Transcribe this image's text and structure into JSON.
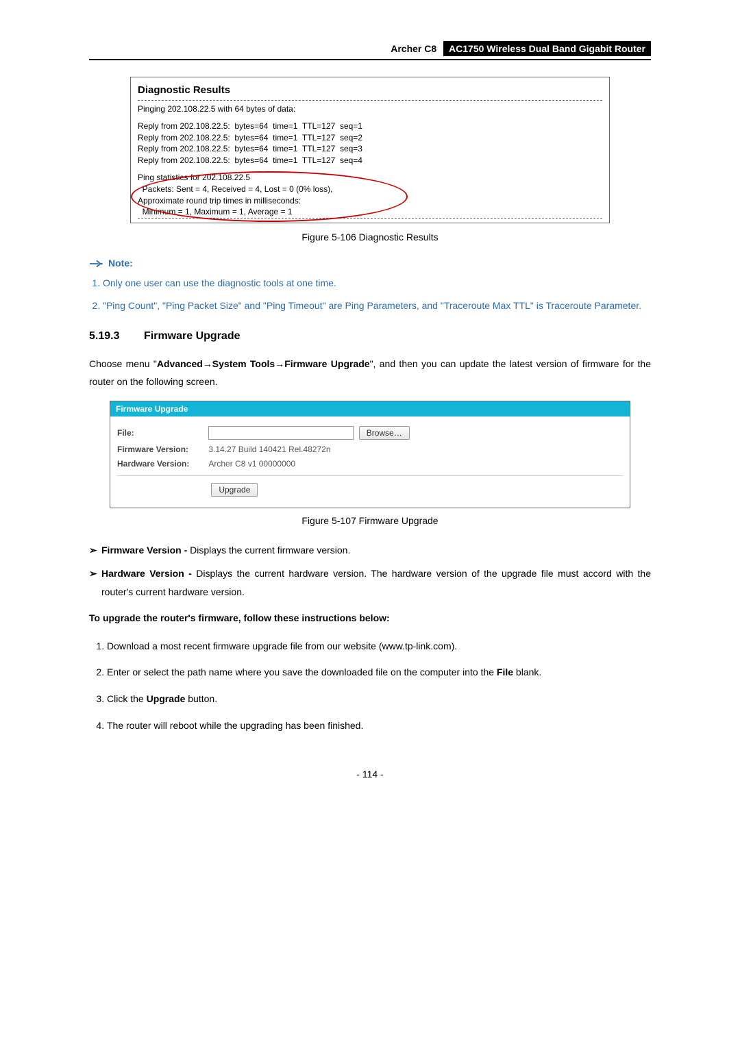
{
  "header": {
    "model": "Archer C8",
    "title": "AC1750 Wireless Dual Band Gigabit Router"
  },
  "diag": {
    "title": "Diagnostic Results",
    "ping_header": "Pinging 202.108.22.5 with 64 bytes of data:",
    "replies": [
      "Reply from 202.108.22.5:  bytes=64  time=1  TTL=127  seq=1",
      "Reply from 202.108.22.5:  bytes=64  time=1  TTL=127  seq=2",
      "Reply from 202.108.22.5:  bytes=64  time=1  TTL=127  seq=3",
      "Reply from 202.108.22.5:  bytes=64  time=1  TTL=127  seq=4"
    ],
    "stats": [
      "Ping statistics for 202.108.22.5",
      "  Packets: Sent = 4, Received = 4, Lost = 0 (0% loss),",
      "Approximate round trip times in milliseconds:",
      "  Minimum = 1, Maximum = 1, Average = 1"
    ],
    "caption": "Figure 5-106 Diagnostic Results"
  },
  "note": {
    "label": "Note:",
    "items": [
      "Only one user can use the diagnostic tools at one time.",
      "\"Ping Count\", \"Ping Packet Size\" and \"Ping Timeout\" are Ping Parameters, and \"Traceroute Max TTL\" is Traceroute Parameter."
    ]
  },
  "section": {
    "num": "5.19.3",
    "title": "Firmware Upgrade"
  },
  "intro": {
    "pre": "Choose menu \"",
    "b1": "Advanced",
    "arr1": "→",
    "b2": "System Tools",
    "arr2": "→",
    "b3": "Firmware Upgrade",
    "post": "\", and then you can update the latest version of firmware for the router on the following screen."
  },
  "fw": {
    "panel_title": "Firmware Upgrade",
    "file_label": "File:",
    "browse_label": "Browse…",
    "fv_label": "Firmware Version:",
    "fv_value": "3.14.27 Build 140421 Rel.48272n",
    "hv_label": "Hardware Version:",
    "hv_value": "Archer C8 v1 00000000",
    "upgrade_label": "Upgrade",
    "caption": "Figure 5-107 Firmware Upgrade"
  },
  "bullets": [
    {
      "b": "Firmware Version -",
      "t": " Displays the current firmware version."
    },
    {
      "b": "Hardware Version -",
      "t": " Displays the current hardware version. The hardware version of the upgrade file must accord with the router's current hardware version."
    }
  ],
  "instr_head": "To upgrade the router's firmware, follow these instructions below:",
  "steps": [
    "Download a most recent firmware upgrade file from our website (www.tp-link.com).",
    {
      "pre": "Enter or select the path name where you save the downloaded file on the computer into the ",
      "b": "File",
      "post": " blank."
    },
    {
      "pre": "Click the ",
      "b": "Upgrade",
      "post": " button."
    },
    "The router will reboot while the upgrading has been finished."
  ],
  "page_num": "- 114 -"
}
